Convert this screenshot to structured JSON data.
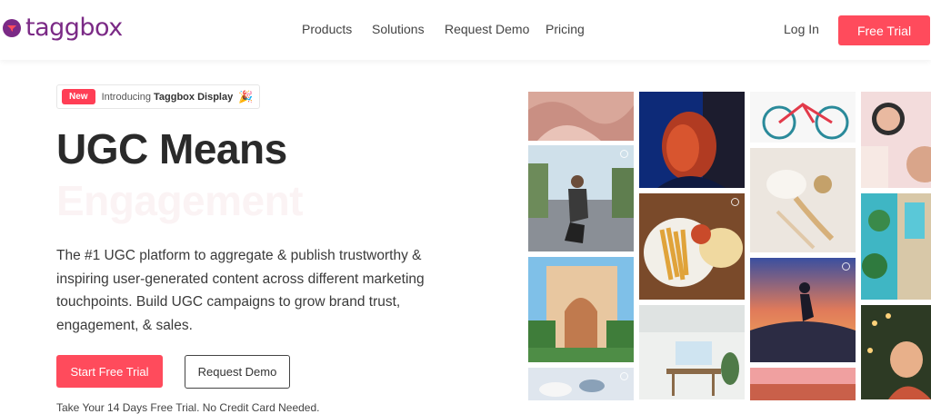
{
  "header": {
    "logo_text": "taggbox",
    "nav": [
      "Products",
      "Solutions",
      "Request Demo",
      "Pricing"
    ],
    "login_label": "Log In",
    "free_trial_label": "Free Trial"
  },
  "announcement": {
    "badge": "New",
    "text": "Introducing",
    "product": "Taggbox Display",
    "emoji": "🎉"
  },
  "hero": {
    "title": "UGC Means",
    "title_faint": "Engagement",
    "description": "The #1 UGC platform to aggregate & publish trustworthy & inspiring user-generated content across different marketing touchpoints. Build UGC campaigns to grow brand trust, engagement, & sales.",
    "cta_primary": "Start Free Trial",
    "cta_secondary": "Request Demo",
    "note": "Take Your 14 Days Free Trial. No Credit Card Needed."
  },
  "colors": {
    "brand": "#7b2a86",
    "accent": "#ff4b5c"
  },
  "gallery": [
    {
      "name": "fabric-texture-photo"
    },
    {
      "name": "portrait-neon-photo"
    },
    {
      "name": "bicycle-photo"
    },
    {
      "name": "makeup-compact-photo"
    },
    {
      "name": "skateboarder-street-photo"
    },
    {
      "name": "jewelry-flatlay-photo"
    },
    {
      "name": "pool-aerial-photo"
    },
    {
      "name": "fries-meal-photo"
    },
    {
      "name": "resort-building-photo"
    },
    {
      "name": "skatepark-sunset-photo"
    },
    {
      "name": "dining-room-photo"
    },
    {
      "name": "child-lights-photo"
    },
    {
      "name": "coffee-cups-photo"
    },
    {
      "name": "landscape-sunset-photo"
    }
  ]
}
